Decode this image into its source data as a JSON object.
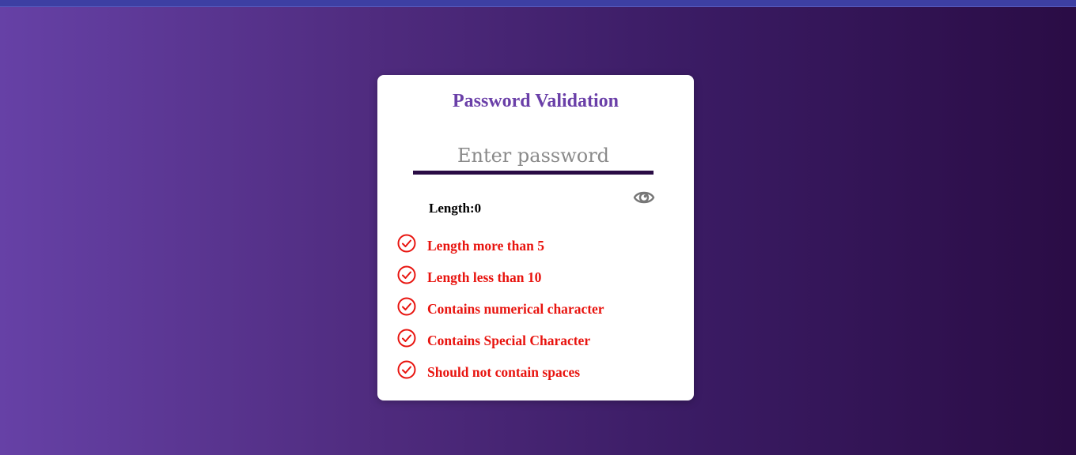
{
  "card": {
    "title": "Password Validation",
    "password_placeholder": "Enter password",
    "password_value": "",
    "length_label": "Length:",
    "length_value": "0"
  },
  "rules": [
    {
      "label": "Length more than 5",
      "status": "unmet"
    },
    {
      "label": "Length less than 10",
      "status": "unmet"
    },
    {
      "label": "Contains numerical character",
      "status": "unmet"
    },
    {
      "label": "Contains Special Character",
      "status": "unmet"
    },
    {
      "label": "Should not contain spaces",
      "status": "unmet"
    }
  ],
  "icons": {
    "visibility_toggle": "eye-icon",
    "rule_status": "check-circle-icon"
  },
  "colors": {
    "accent": "#6a3fa8",
    "unmet_rule": "#e8140f",
    "input_underline": "#2a0c45"
  }
}
